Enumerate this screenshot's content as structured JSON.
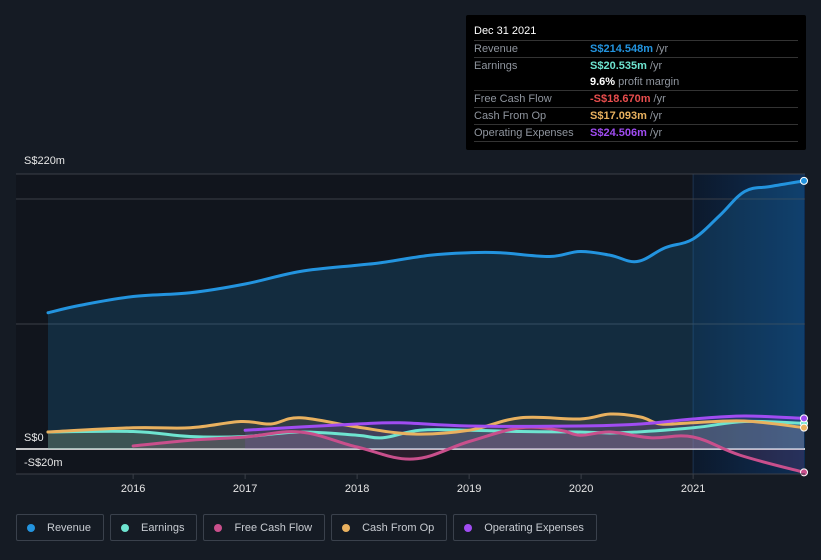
{
  "tooltip": {
    "date": "Dec 31 2021",
    "rows": [
      {
        "label": "Revenue",
        "value": "S$214.548m",
        "unit": "/yr",
        "color": "#2394df"
      },
      {
        "label": "Earnings",
        "value": "S$20.535m",
        "unit": "/yr",
        "color": "#6ee4d0"
      },
      {
        "label": "",
        "value": "9.6%",
        "unit": "profit margin",
        "color": "#ffffff"
      },
      {
        "label": "Free Cash Flow",
        "value": "-S$18.670m",
        "unit": "/yr",
        "color": "#e84d4d"
      },
      {
        "label": "Cash From Op",
        "value": "S$17.093m",
        "unit": "/yr",
        "color": "#e9b15f"
      },
      {
        "label": "Operating Expenses",
        "value": "S$24.506m",
        "unit": "/yr",
        "color": "#a04cf2"
      }
    ]
  },
  "legend": [
    {
      "label": "Revenue",
      "color": "#2394df"
    },
    {
      "label": "Earnings",
      "color": "#6ee4d0"
    },
    {
      "label": "Free Cash Flow",
      "color": "#c94f8c"
    },
    {
      "label": "Cash From Op",
      "color": "#e9b15f"
    },
    {
      "label": "Operating Expenses",
      "color": "#a04cf2"
    }
  ],
  "chart_data": {
    "type": "line",
    "title": "",
    "xlabel": "",
    "ylabel": "",
    "currency_unit": "S$ millions",
    "ylim": [
      -20,
      220
    ],
    "y_tick_labels": [
      {
        "value": 220,
        "label": "S$220m"
      },
      {
        "value": 0,
        "label": "S$0"
      },
      {
        "value": -20,
        "label": "-S$20m"
      }
    ],
    "y_gridlines": [
      220,
      200,
      100,
      0,
      -20
    ],
    "x_ticks": [
      2016,
      2017,
      2018,
      2019,
      2020,
      2021
    ],
    "xlim": [
      2015.24,
      2021.99
    ],
    "highlight_from": 2021.0,
    "legend_position": "bottom",
    "series": [
      {
        "name": "Revenue",
        "color": "#2394df",
        "fill": true,
        "x": [
          2015.24,
          2015.53,
          2016.0,
          2016.51,
          2017.0,
          2017.49,
          2018.0,
          2018.21,
          2018.65,
          2019.0,
          2019.28,
          2019.72,
          2019.99,
          2020.26,
          2020.5,
          2020.75,
          2021.0,
          2021.24,
          2021.46,
          2021.69,
          2021.99
        ],
        "y": [
          109,
          115,
          122,
          125,
          132,
          142,
          147,
          149,
          155,
          157,
          157,
          154,
          158,
          155,
          150,
          161,
          168,
          187,
          206,
          210,
          214.5
        ]
      },
      {
        "name": "Earnings",
        "color": "#6ee4d0",
        "fill": true,
        "x": [
          2015.24,
          2016.0,
          2016.51,
          2017.0,
          2017.49,
          2018.0,
          2018.23,
          2018.56,
          2019.0,
          2019.46,
          2019.99,
          2020.35,
          2021.0,
          2021.46,
          2021.99
        ],
        "y": [
          13.6,
          14,
          10,
          10,
          13.6,
          11,
          9,
          15,
          15,
          14,
          13.6,
          13,
          17,
          22,
          20.5
        ]
      },
      {
        "name": "Free Cash Flow",
        "color": "#c94f8c",
        "fill": true,
        "x": [
          2016.0,
          2016.51,
          2017.0,
          2017.49,
          2018.0,
          2018.5,
          2019.0,
          2019.46,
          2019.81,
          2019.99,
          2020.26,
          2020.62,
          2021.0,
          2021.42,
          2021.99
        ],
        "y": [
          2.4,
          7,
          9.6,
          13.6,
          1.6,
          -8,
          6,
          17,
          15,
          11,
          13.6,
          9,
          9.6,
          -5,
          -18.67
        ]
      },
      {
        "name": "Cash From Op",
        "color": "#e9b15f",
        "fill": true,
        "x": [
          2015.24,
          2016.0,
          2016.51,
          2016.96,
          2017.23,
          2017.49,
          2018.0,
          2018.5,
          2019.0,
          2019.46,
          2019.99,
          2020.26,
          2020.53,
          2020.71,
          2021.0,
          2021.46,
          2021.99
        ],
        "y": [
          13.6,
          17,
          17,
          22,
          20,
          25,
          17.6,
          12,
          15,
          25,
          24,
          28,
          25.6,
          20,
          21,
          22.4,
          17.1
        ]
      },
      {
        "name": "Operating Expenses",
        "color": "#a04cf2",
        "fill": true,
        "x": [
          2017.0,
          2017.49,
          2018.0,
          2018.38,
          2019.0,
          2019.99,
          2020.53,
          2021.0,
          2021.46,
          2021.99
        ],
        "y": [
          15,
          17.6,
          20,
          21,
          18.4,
          18.4,
          20,
          24,
          26.4,
          24.5
        ]
      }
    ]
  }
}
